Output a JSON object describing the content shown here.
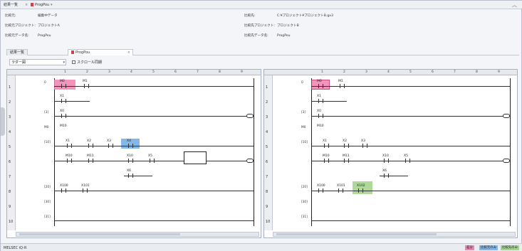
{
  "tabs": {
    "results_list": "結果一覧",
    "progpou": "ProgPou"
  },
  "info": {
    "left": [
      {
        "k": "比較元:",
        "v": "編集中データ"
      },
      {
        "k": "比較元プロジェクト:",
        "v": "プロジェクトA"
      },
      {
        "k": "比較元データ名:",
        "v": "ProgPou"
      }
    ],
    "right": [
      {
        "k": "比較先:",
        "v": "C:¥プロジェクト¥プロジェクトB.gx3"
      },
      {
        "k": "比較先プロジェクト:",
        "v": "プロジェクトB"
      },
      {
        "k": "比較先データ名:",
        "v": "ProgPou"
      }
    ]
  },
  "toolbar": {
    "view_select": "ラダー図",
    "sync_scroll": "スクロール同期"
  },
  "ruler_cols": [
    "1",
    "2",
    "3",
    "4",
    "5",
    "6",
    "7",
    "8",
    "9"
  ],
  "rows": [
    "1",
    "2",
    "3",
    "4",
    "5",
    "6",
    "7",
    "8",
    "9",
    "10"
  ],
  "ladder_left": {
    "steps": [
      "0",
      "[3]",
      "",
      "M0",
      "[10]",
      "",
      "",
      "[20]",
      "[30]",
      "[31]"
    ],
    "devices": {
      "m0": "M0",
      "m1": "M1",
      "x1": "X1",
      "x0": "X0",
      "x2": "X2",
      "x3": "X3",
      "x4": "X4",
      "m10": "M10",
      "m11": "M11",
      "x10": "X10",
      "x5": "X5",
      "x6": "X6",
      "x100": "X100",
      "x101": "X101",
      "m_nc": "M10"
    }
  },
  "ladder_right": {
    "steps": [
      "0",
      "[3]",
      "",
      "M0",
      "[10]",
      "",
      "",
      "[20]",
      "[30]",
      "[31]"
    ],
    "devices": {
      "m0": "M0",
      "m1": "M1",
      "x1": "X1",
      "x0": "X0",
      "x2": "X2",
      "x3": "X3",
      "m10": "M10",
      "m11": "M11",
      "x10": "X10",
      "x5": "X5",
      "x6": "X6",
      "x100": "X100",
      "x101": "X101",
      "x102": "X102"
    }
  },
  "status": {
    "text": "MELSEC iQ-R",
    "legend": [
      "差分",
      "比較元のみ",
      "比較先のみ"
    ]
  },
  "colors": {
    "pink": "#ef83b1",
    "blue": "#84b6e6",
    "green": "#a6d48f"
  }
}
